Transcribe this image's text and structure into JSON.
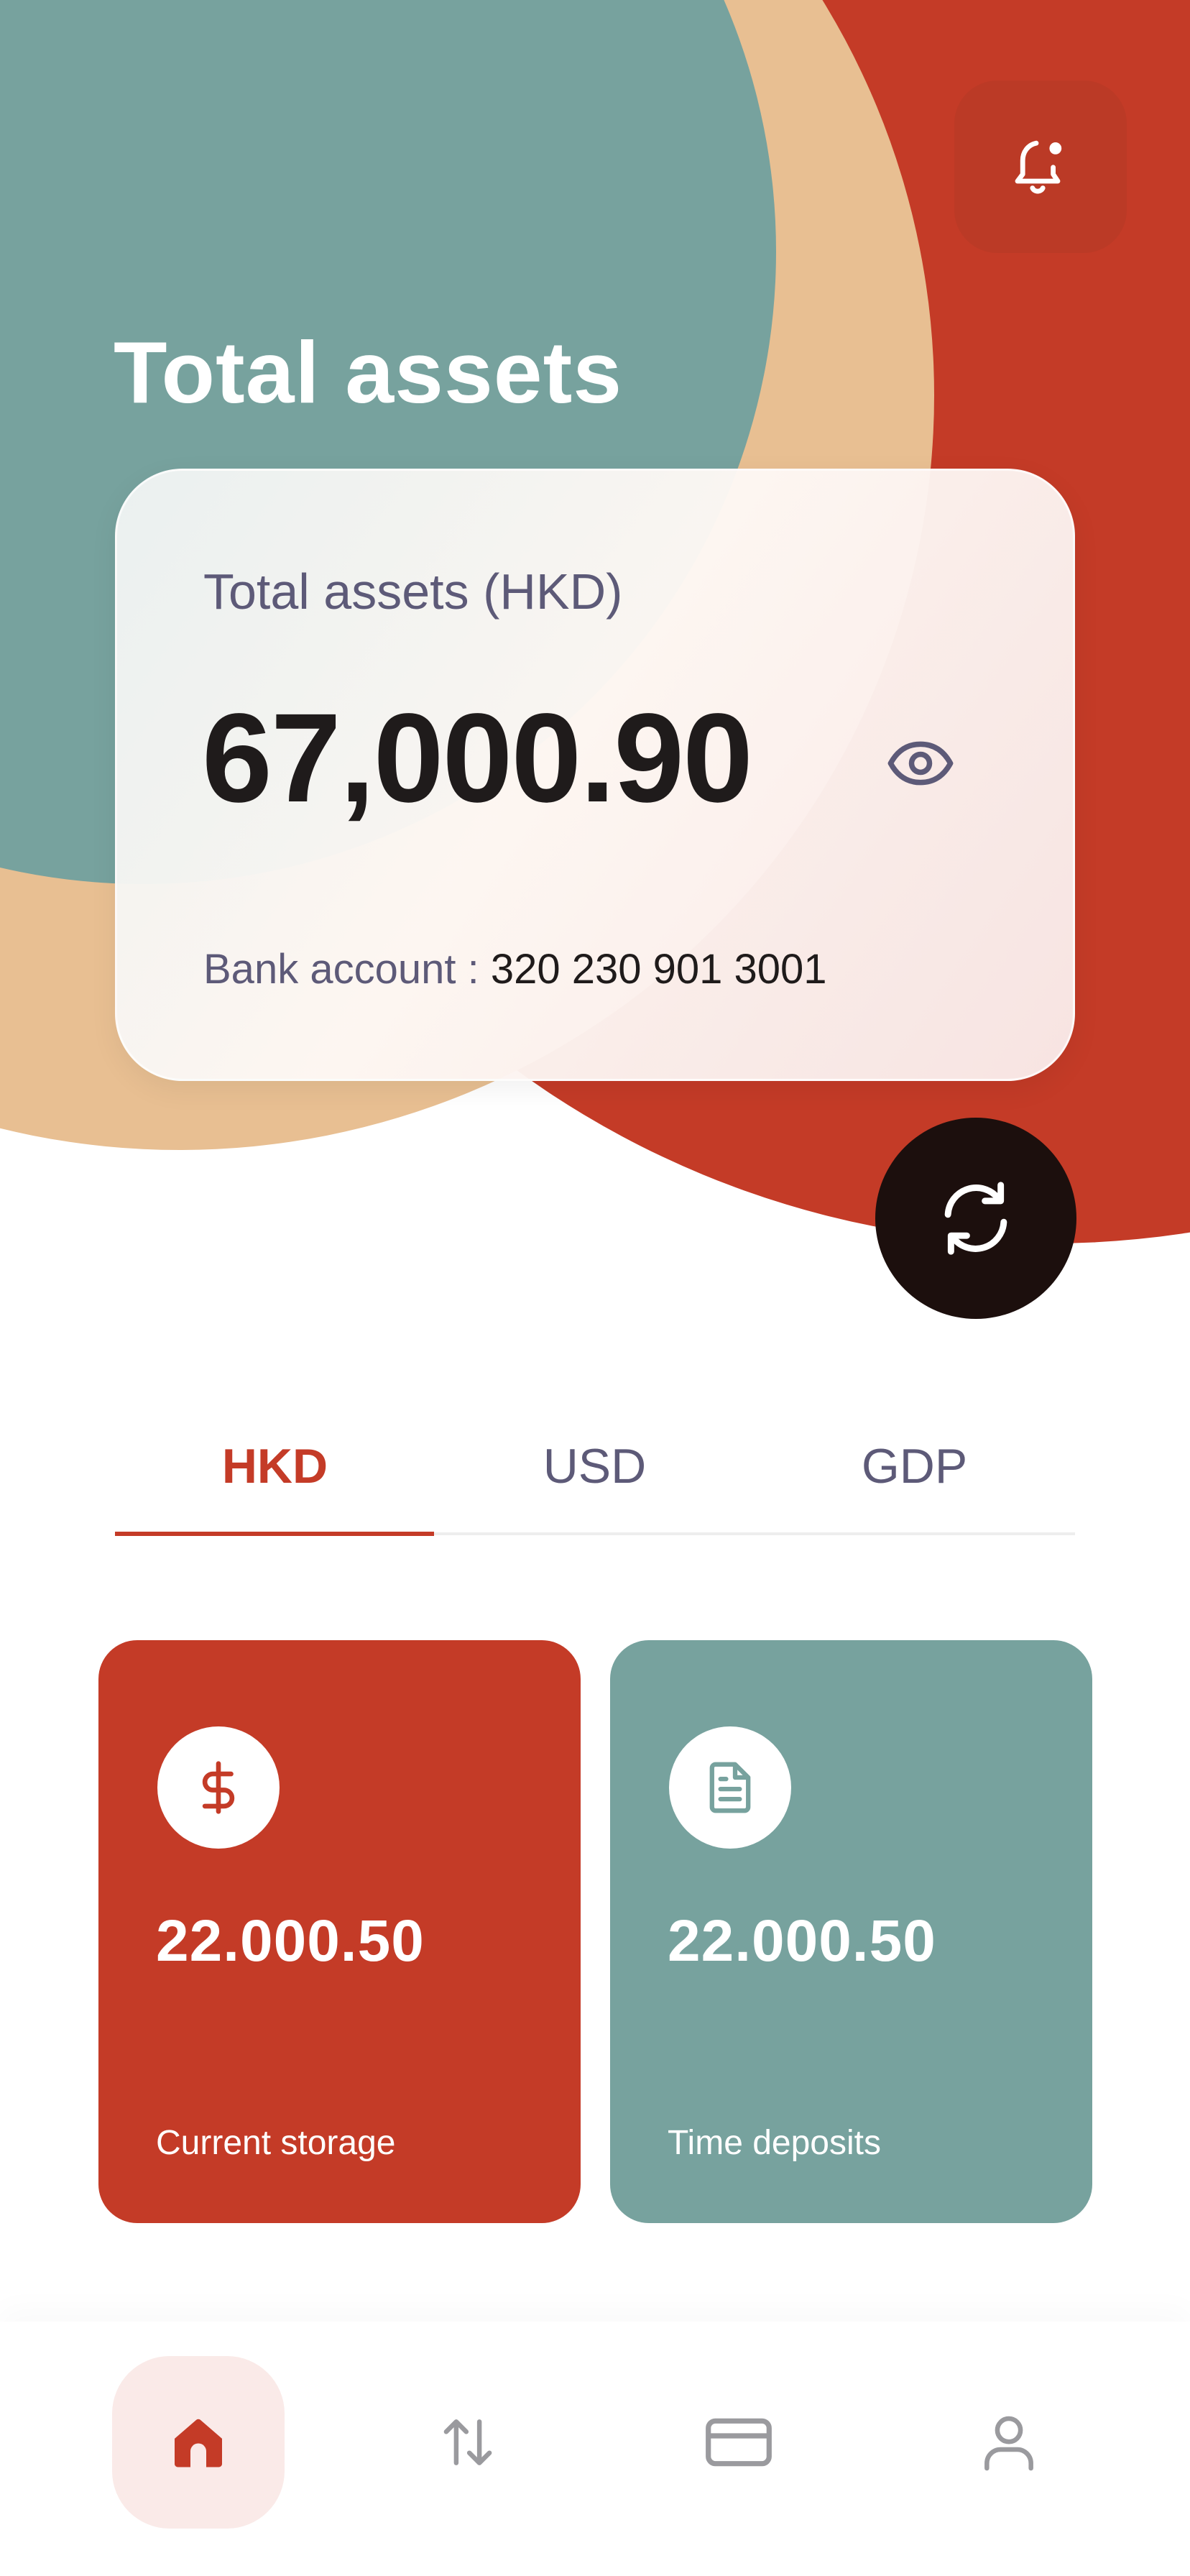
{
  "colors": {
    "brand_red": "#c43b27",
    "teal": "#77a29e",
    "sand": "#e8bf92",
    "dark": "#1c0f0d",
    "muted_text": "#5d5a78"
  },
  "header": {
    "title": "Total assets",
    "notification_icon": "bell-alert-icon"
  },
  "assets_card": {
    "label": "Total assets (HKD)",
    "amount": "67,000.90",
    "visibility_icon": "eye-icon",
    "bank_account_label": "Bank account :",
    "bank_account_number": "320 230 901 3001"
  },
  "refresh_icon": "refresh-icon",
  "currency_tabs": [
    {
      "label": "HKD",
      "active": true
    },
    {
      "label": "USD",
      "active": false
    },
    {
      "label": "GDP",
      "active": false
    }
  ],
  "stats": [
    {
      "icon": "dollar-icon",
      "value": "22.000.50",
      "label": "Current storage",
      "color": "#c43b27"
    },
    {
      "icon": "document-icon",
      "value": "22.000.50",
      "label": "Time deposits",
      "color": "#77a29e"
    }
  ],
  "bottom_nav": [
    {
      "icon": "home-icon",
      "active": true
    },
    {
      "icon": "transfer-icon",
      "active": false
    },
    {
      "icon": "card-icon",
      "active": false
    },
    {
      "icon": "profile-icon",
      "active": false
    }
  ]
}
